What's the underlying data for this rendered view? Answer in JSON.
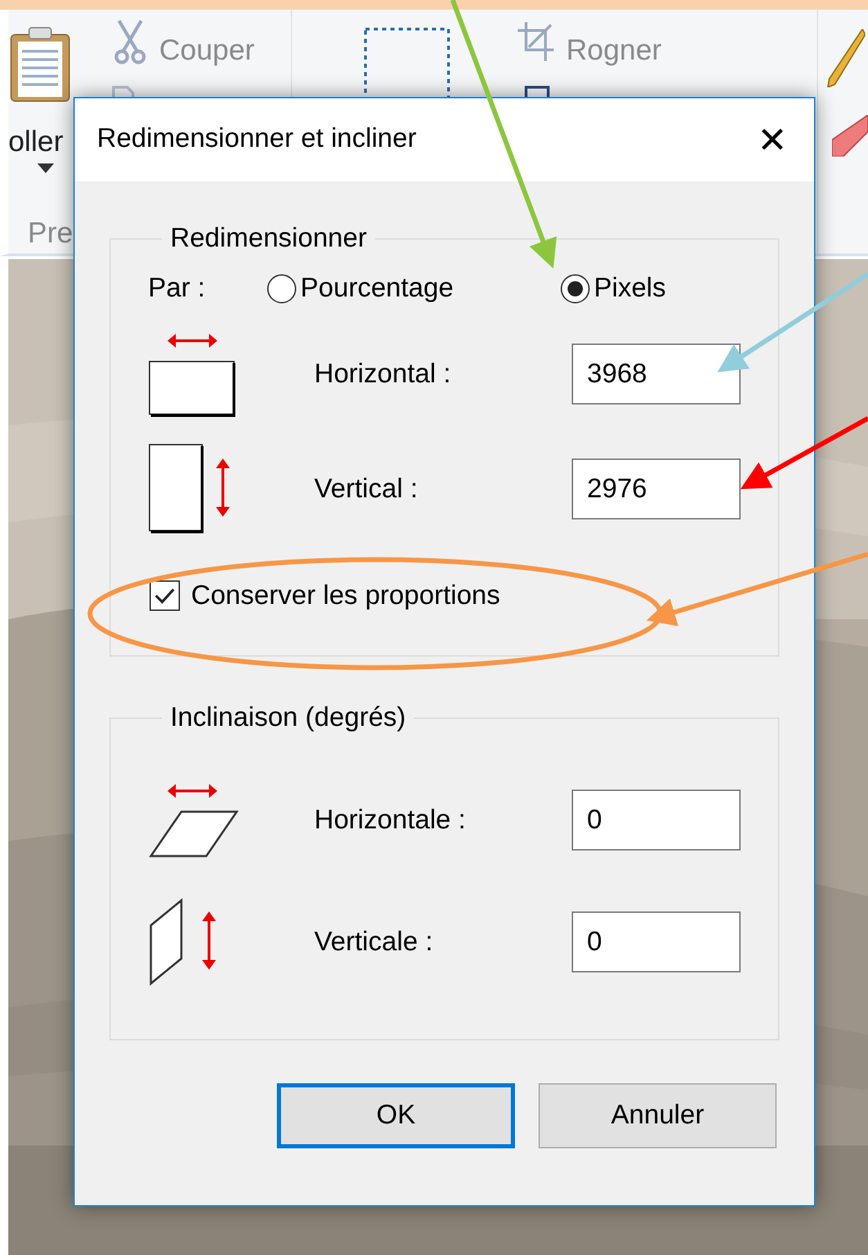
{
  "ribbon": {
    "paste_label": "oller",
    "cut_label": "Couper",
    "crop_label": "Rogner",
    "group_label": "Pre"
  },
  "dialog": {
    "title": "Redimensionner et incliner",
    "close": "✕",
    "resize": {
      "legend": "Redimensionner",
      "by_label": "Par :",
      "options": [
        {
          "label": "Pourcentage",
          "selected": false
        },
        {
          "label": "Pixels",
          "selected": true
        }
      ],
      "fields": [
        {
          "kind": "horizontal",
          "label": "Horizontal :",
          "value": "3968"
        },
        {
          "kind": "vertical",
          "label": "Vertical :",
          "value": "2976"
        }
      ],
      "keep_ratio": {
        "label": "Conserver les proportions",
        "checked": true
      }
    },
    "skew": {
      "legend": "Inclinaison (degrés)",
      "fields": [
        {
          "kind": "horizontal",
          "label": "Horizontale :",
          "value": "0"
        },
        {
          "kind": "vertical",
          "label": "Verticale :",
          "value": "0"
        }
      ]
    },
    "buttons": [
      {
        "label": "OK",
        "default": true
      },
      {
        "label": "Annuler",
        "default": false
      }
    ]
  }
}
